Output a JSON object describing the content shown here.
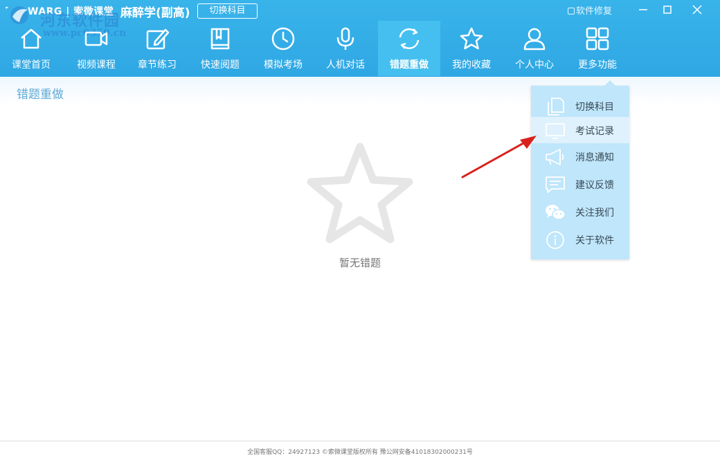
{
  "titlebar": {
    "brand": "WARG | 索微课堂",
    "subject": "麻醉学(副高)",
    "switch_label": "切换科目",
    "repair_label": "软件修复",
    "watermark_main": "河东软件园",
    "watermark_url": "www.pc0359.cn"
  },
  "nav": {
    "items": [
      {
        "label": "课堂首页",
        "icon": "home-icon"
      },
      {
        "label": "视频课程",
        "icon": "video-icon"
      },
      {
        "label": "章节练习",
        "icon": "pencil-icon"
      },
      {
        "label": "快速阅题",
        "icon": "book-icon"
      },
      {
        "label": "模拟考场",
        "icon": "clock-icon"
      },
      {
        "label": "人机对话",
        "icon": "microphone-icon"
      },
      {
        "label": "错题重做",
        "icon": "refresh-icon"
      },
      {
        "label": "我的收藏",
        "icon": "star-icon"
      },
      {
        "label": "个人中心",
        "icon": "user-icon"
      },
      {
        "label": "更多功能",
        "icon": "grid-icon"
      }
    ],
    "active_index": 6
  },
  "page": {
    "title": "错题重做",
    "empty_text": "暂无错题"
  },
  "dropdown": {
    "items": [
      {
        "label": "切换科目",
        "icon": "documents-icon"
      },
      {
        "label": "考试记录",
        "icon": "monitor-icon"
      },
      {
        "label": "消息通知",
        "icon": "megaphone-icon"
      },
      {
        "label": "建议反馈",
        "icon": "comment-icon"
      },
      {
        "label": "关注我们",
        "icon": "wechat-icon"
      },
      {
        "label": "关于软件",
        "icon": "info-icon"
      }
    ],
    "highlighted_index": 1
  },
  "footer": {
    "text": "全国客服QQ：24927123 ©索微课堂版权所有 豫公网安备41018302000231号"
  },
  "colors": {
    "header": "#35aee8",
    "active_tab": "#45bfef",
    "dropdown": "#bfe6fb",
    "arrow": "#d9211c"
  }
}
